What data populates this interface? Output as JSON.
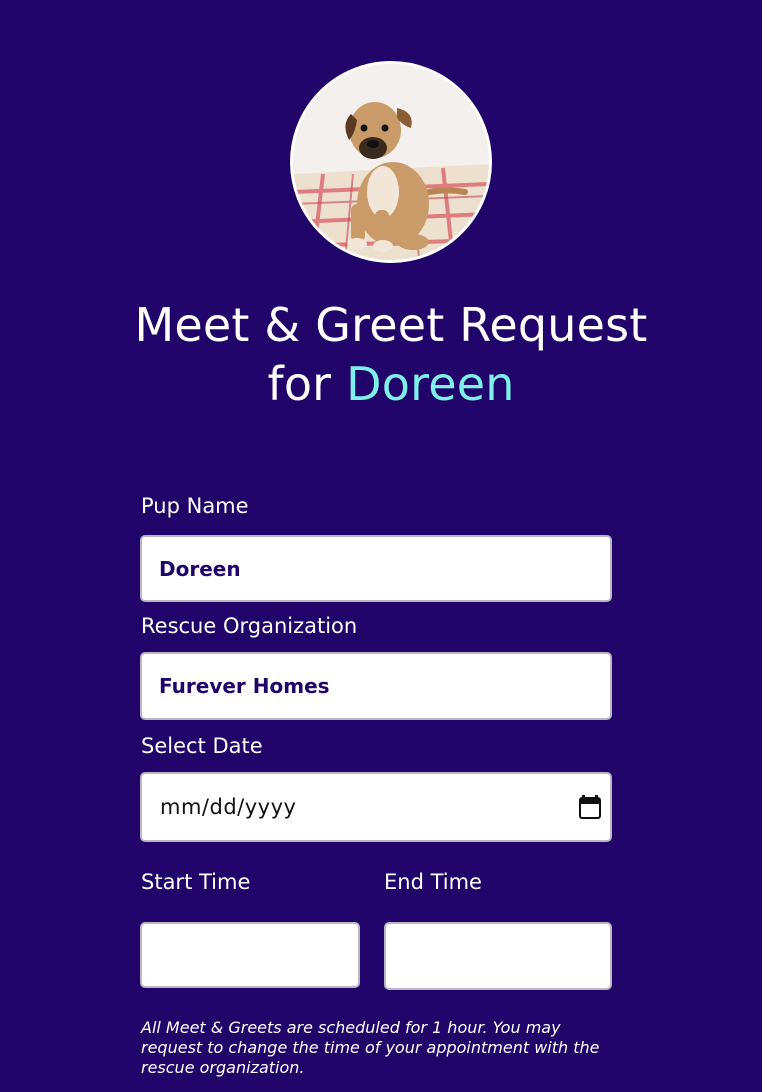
{
  "header": {
    "title_line1": "Meet & Greet Request",
    "title_for": "for",
    "pup_name": "Doreen"
  },
  "avatar": {
    "icon": "puppy-photo",
    "alt": "Doreen"
  },
  "form": {
    "pup_name": {
      "label": "Pup Name",
      "value": "Doreen"
    },
    "rescue_org": {
      "label": "Rescue Organization",
      "value": "Furever Homes"
    },
    "date": {
      "label": "Select Date",
      "placeholder": "mm/dd/yyyy",
      "icon": "calendar-icon"
    },
    "start_time": {
      "label": "Start Time",
      "value": ""
    },
    "end_time": {
      "label": "End Time",
      "value": ""
    }
  },
  "note": "All Meet & Greets are scheduled for 1 hour. You may request to change the time of your appointment with the rescue organization.",
  "colors": {
    "background": "#21046a",
    "accent": "#7ef0e8",
    "field_text": "#21046a"
  }
}
